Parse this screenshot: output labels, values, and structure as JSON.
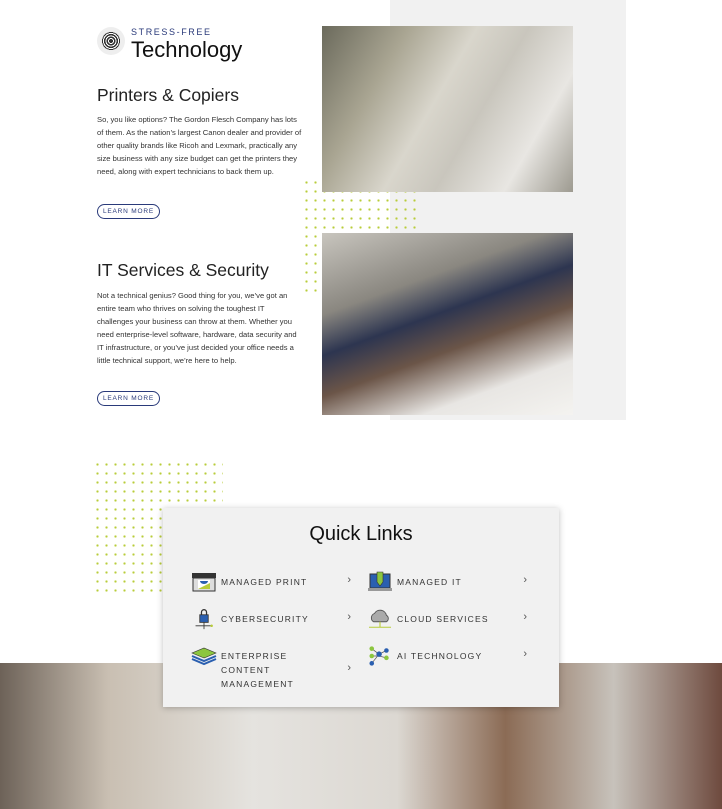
{
  "header": {
    "kicker": "STRESS-FREE",
    "title": "Technology"
  },
  "sections": [
    {
      "heading": "Printers & Copiers",
      "body": "So, you like options? The Gordon Flesch Company has lots of them. As the nation’s largest Canon dealer and provider of other quality brands like Ricoh and Lexmark, practically any size business with any size budget can get the printers they need, along with expert technicians to back them up.",
      "button": "LEARN MORE"
    },
    {
      "heading": "IT Services & Security",
      "body": "Not a technical genius? Good thing for you, we’ve got an entire team who thrives on solving the toughest IT challenges your business can throw at them. Whether you need enterprise-level software, hardware, data security and IT infrastructure, or you’ve just decided your office needs a little technical support, we’re here to help.",
      "button": "LEARN MORE"
    }
  ],
  "quick_links": {
    "title": "Quick Links",
    "items": [
      {
        "label": "MANAGED PRINT",
        "icon": "printer-icon"
      },
      {
        "label": "MANAGED IT",
        "icon": "laptop-icon"
      },
      {
        "label": "CYBERSECURITY",
        "icon": "lock-icon"
      },
      {
        "label": "CLOUD SERVICES",
        "icon": "cloud-icon"
      },
      {
        "label": "ENTERPRISE CONTENT MANAGEMENT",
        "icon": "layers-icon"
      },
      {
        "label": "AI TECHNOLOGY",
        "icon": "network-icon"
      }
    ],
    "chevron": "›"
  },
  "colors": {
    "accent": "#2a3a7a",
    "dots": "#b8cc3a",
    "panel": "#f1f1f1"
  }
}
